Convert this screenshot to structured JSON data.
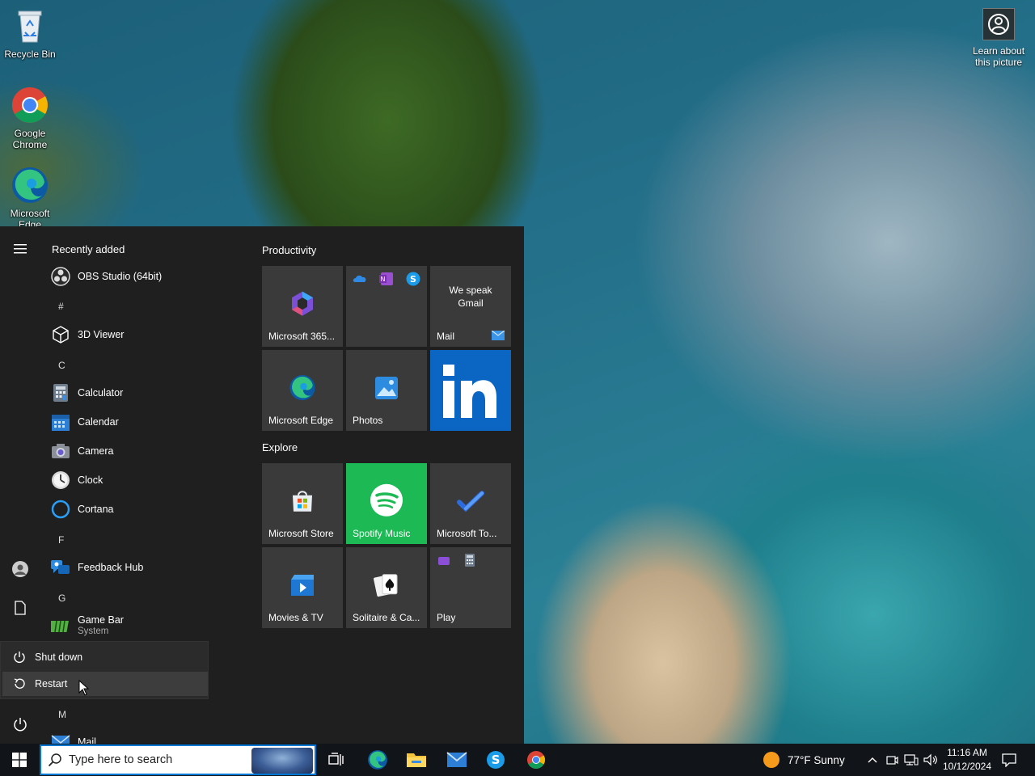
{
  "desktop": {
    "icons": [
      {
        "label": "Recycle Bin"
      },
      {
        "label": "Google Chrome"
      },
      {
        "label": "Microsoft Edge"
      }
    ],
    "learn_about": "Learn about this picture"
  },
  "start_menu": {
    "recently_added_label": "Recently added",
    "apps": {
      "obs": "OBS Studio (64bit)",
      "hash": "#",
      "viewer3d": "3D Viewer",
      "letter_c": "C",
      "calculator": "Calculator",
      "calendar": "Calendar",
      "camera": "Camera",
      "clock": "Clock",
      "cortana": "Cortana",
      "letter_f": "F",
      "feedback": "Feedback Hub",
      "letter_g": "G",
      "gamebar": "Game Bar",
      "gamebar_sub": "System",
      "letter_m": "M",
      "mail": "Mail"
    },
    "power_menu": {
      "shutdown": "Shut down",
      "restart": "Restart"
    },
    "groups": {
      "productivity": "Productivity",
      "explore": "Explore"
    },
    "tiles": {
      "m365": "Microsoft 365...",
      "mail": "Mail",
      "mail_promo": "We speak Gmail",
      "edge": "Microsoft Edge",
      "photos": "Photos",
      "store": "Microsoft Store",
      "spotify": "Spotify Music",
      "todo": "Microsoft To...",
      "movies": "Movies & TV",
      "solitaire": "Solitaire & Ca...",
      "play": "Play"
    }
  },
  "taskbar": {
    "search_placeholder": "Type here to search",
    "weather": "77°F  Sunny",
    "time": "11:16 AM",
    "date": "10/12/2024"
  },
  "colors": {
    "accent": "#0078d4",
    "spotify": "#1db954",
    "linkedin": "#0a66c2",
    "menu_bg": "#1f1f1f",
    "tile_bg": "#3a3a3a"
  }
}
